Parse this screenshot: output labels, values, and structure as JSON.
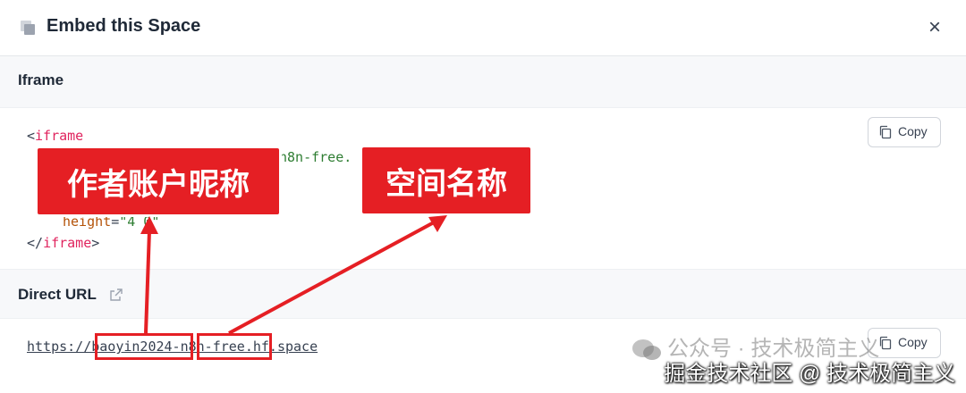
{
  "dialog": {
    "title": "Embed this Space",
    "close_glyph": "×"
  },
  "iframe_section": {
    "title": "Iframe",
    "code_lines": {
      "line1_tag_open": "<",
      "line1_tag_name": "iframe",
      "line2_visible_fragment": "n8n-free.",
      "line5_attr": "height",
      "line5_value": "\"4 0\"",
      "line6_tag_open": "</",
      "line6_tag_name": "iframe",
      "line6_tag_close": ">"
    },
    "copy_label": "Copy"
  },
  "direct_url_section": {
    "title": "Direct URL",
    "url": "https://baoyin2024-n8n-free.hf.space",
    "copy_label": "Copy"
  },
  "annotations": {
    "account_label": "作者账户昵称",
    "space_label": "空间名称",
    "color": "#e51f24"
  },
  "watermark": {
    "line1": "公众号 · 技术极简主义",
    "line2": "掘金技术社区 @ 技术极简主义"
  },
  "icons": {
    "header": "embed-icon",
    "close": "close-icon",
    "copy": "copy-icon",
    "external": "external-link-icon"
  }
}
